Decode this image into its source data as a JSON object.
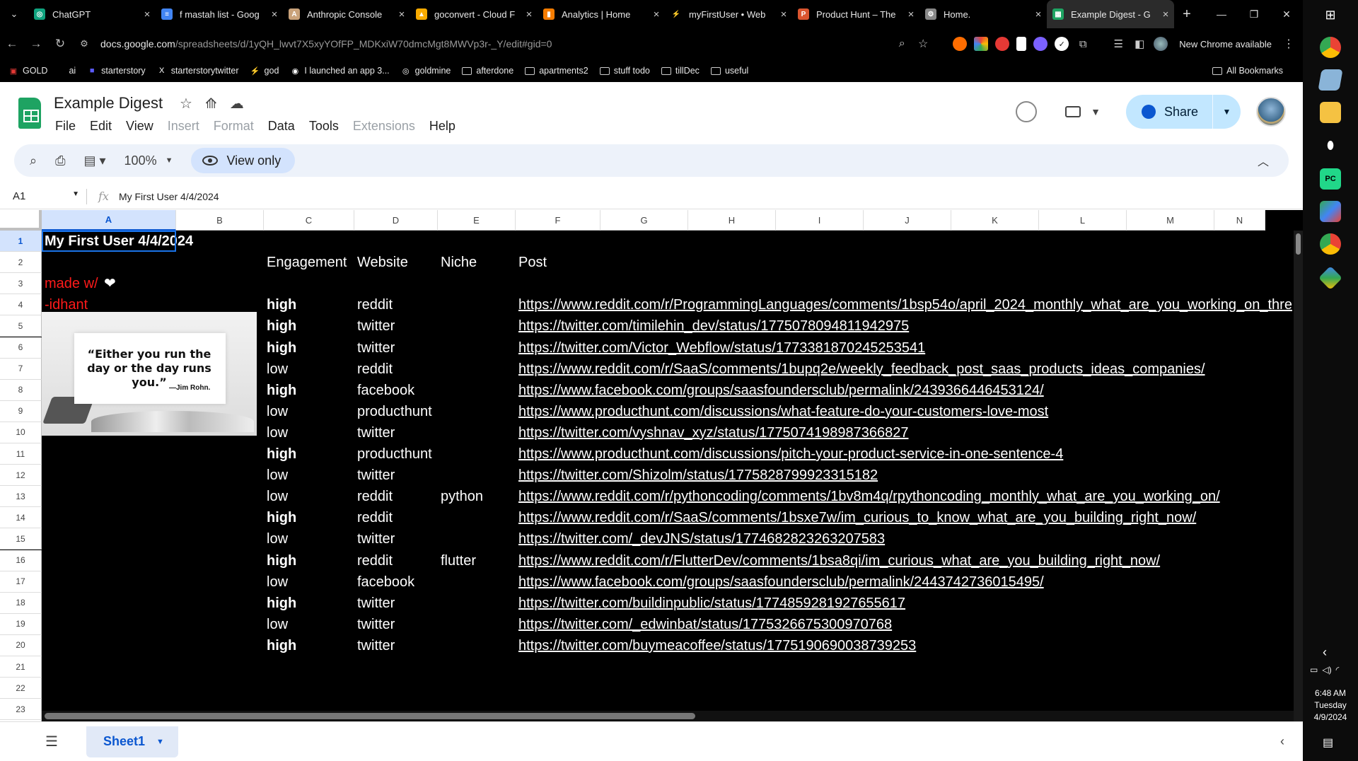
{
  "browser": {
    "tabs": [
      {
        "title": "ChatGPT",
        "color": "#10a37f",
        "glyph": "◎"
      },
      {
        "title": "f mastah list - Goog",
        "color": "#4285f4",
        "glyph": "≡"
      },
      {
        "title": "Anthropic Console",
        "color": "#c9a27a",
        "glyph": "A"
      },
      {
        "title": "goconvert - Cloud F",
        "color": "#f9ab00",
        "glyph": "▲"
      },
      {
        "title": "Analytics | Home",
        "color": "#f57c00",
        "glyph": "▮"
      },
      {
        "title": "myFirstUser • Web",
        "color": "#ffffff",
        "glyph": "⚡"
      },
      {
        "title": "Product Hunt – The",
        "color": "#da552f",
        "glyph": "P"
      },
      {
        "title": "Home.",
        "color": "#888888",
        "glyph": "⚙"
      },
      {
        "title": "Example Digest - G",
        "color": "#1ea362",
        "glyph": "▦"
      }
    ],
    "url_host": "docs.google.com",
    "url_path": "/spreadsheets/d/1yQH_lwvt7X5xyYOfFP_MDKxiW70dmcMgt8MWVp3r-_Y/edit#gid=0",
    "new_chrome_label": "New Chrome available",
    "bookmarks": [
      {
        "label": "GOLD",
        "kind": "icon",
        "color": "#e53935",
        "glyph": "▣"
      },
      {
        "label": "ai",
        "kind": "text"
      },
      {
        "label": "starterstory",
        "kind": "icon",
        "color": "#5b5bff",
        "glyph": "■"
      },
      {
        "label": "starterstorytwitter",
        "kind": "icon",
        "color": "#fff",
        "glyph": "X"
      },
      {
        "label": "god",
        "kind": "icon",
        "color": "#fff",
        "glyph": "⚡"
      },
      {
        "label": "I launched an app 3...",
        "kind": "icon",
        "color": "#fff",
        "glyph": "◉"
      },
      {
        "label": "goldmine",
        "kind": "icon",
        "color": "#fff",
        "glyph": "◎"
      },
      {
        "label": "afterdone",
        "kind": "folder"
      },
      {
        "label": "apartments2",
        "kind": "folder"
      },
      {
        "label": "stuff todo",
        "kind": "folder"
      },
      {
        "label": "tillDec",
        "kind": "folder"
      },
      {
        "label": "useful",
        "kind": "folder"
      }
    ],
    "all_bookmarks_label": "All Bookmarks"
  },
  "sheets": {
    "title": "Example Digest",
    "menu": [
      {
        "label": "File",
        "enabled": true
      },
      {
        "label": "Edit",
        "enabled": true
      },
      {
        "label": "View",
        "enabled": true
      },
      {
        "label": "Insert",
        "enabled": false
      },
      {
        "label": "Format",
        "enabled": false
      },
      {
        "label": "Data",
        "enabled": true
      },
      {
        "label": "Tools",
        "enabled": true
      },
      {
        "label": "Extensions",
        "enabled": false
      },
      {
        "label": "Help",
        "enabled": true
      }
    ],
    "share_label": "Share",
    "zoom": "100%",
    "view_only_label": "View only",
    "name_box": "A1",
    "formula": "My First User 4/4/2024",
    "columns": [
      "A",
      "B",
      "C",
      "D",
      "E",
      "F",
      "G",
      "H",
      "I",
      "J",
      "K",
      "L",
      "M",
      "N"
    ],
    "row_count": 24,
    "sheet_tab": "Sheet1"
  },
  "content": {
    "title": "My First User 4/4/2024",
    "made_with": "made w/ ",
    "heart": "❤",
    "author": "-idhant",
    "quote": "“Either you run the day or the day runs you.”",
    "quote_author": "—Jim Rohn.",
    "headers": {
      "engagement": "Engagement",
      "website": "Website",
      "niche": "Niche",
      "post": "Post"
    },
    "rows": [
      {
        "row": 4,
        "engagement": "high",
        "website": "reddit",
        "niche": "",
        "post": "https://www.reddit.com/r/ProgrammingLanguages/comments/1bsp54o/april_2024_monthly_what_are_you_working_on_thre"
      },
      {
        "row": 5,
        "engagement": "high",
        "website": "twitter",
        "niche": "",
        "post": "https://twitter.com/timilehin_dev/status/1775078094811942975"
      },
      {
        "row": 6,
        "engagement": "high",
        "website": "twitter",
        "niche": "",
        "post": "https://twitter.com/Victor_Webflow/status/1773381870245253541"
      },
      {
        "row": 7,
        "engagement": "low",
        "website": "reddit",
        "niche": "",
        "post": "https://www.reddit.com/r/SaaS/comments/1bupq2e/weekly_feedback_post_saas_products_ideas_companies/"
      },
      {
        "row": 8,
        "engagement": "high",
        "website": "facebook",
        "niche": "",
        "post": "https://www.facebook.com/groups/saasfoundersclub/permalink/2439366446453124/"
      },
      {
        "row": 9,
        "engagement": "low",
        "website": "producthunt",
        "niche": "",
        "post": "https://www.producthunt.com/discussions/what-feature-do-your-customers-love-most"
      },
      {
        "row": 10,
        "engagement": "low",
        "website": "twitter",
        "niche": "",
        "post": "https://twitter.com/vyshnav_xyz/status/1775074198987366827"
      },
      {
        "row": 11,
        "engagement": "high",
        "website": "producthunt",
        "niche": "",
        "post": "https://www.producthunt.com/discussions/pitch-your-product-service-in-one-sentence-4"
      },
      {
        "row": 12,
        "engagement": "low",
        "website": "twitter",
        "niche": "",
        "post": "https://twitter.com/Shizolm/status/1775828799923315182"
      },
      {
        "row": 13,
        "engagement": "low",
        "website": "reddit",
        "niche": "python",
        "post": "https://www.reddit.com/r/pythoncoding/comments/1bv8m4q/rpythoncoding_monthly_what_are_you_working_on/"
      },
      {
        "row": 14,
        "engagement": "high",
        "website": "reddit",
        "niche": "",
        "post": "https://www.reddit.com/r/SaaS/comments/1bsxe7w/im_curious_to_know_what_are_you_building_right_now/"
      },
      {
        "row": 15,
        "engagement": "low",
        "website": "twitter",
        "niche": "",
        "post": "https://twitter.com/_devJNS/status/1774682823263207583"
      },
      {
        "row": 16,
        "engagement": "high",
        "website": "reddit",
        "niche": "flutter",
        "post": "https://www.reddit.com/r/FlutterDev/comments/1bsa8qi/im_curious_what_are_you_building_right_now/"
      },
      {
        "row": 17,
        "engagement": "low",
        "website": "facebook",
        "niche": "",
        "post": "https://www.facebook.com/groups/saasfoundersclub/permalink/2443742736015495/"
      },
      {
        "row": 18,
        "engagement": "high",
        "website": "twitter",
        "niche": "",
        "post": "https://twitter.com/buildinpublic/status/1774859281927655617"
      },
      {
        "row": 19,
        "engagement": "low",
        "website": "twitter",
        "niche": "",
        "post": "https://twitter.com/_edwinbat/status/1775326675300970768"
      },
      {
        "row": 20,
        "engagement": "high",
        "website": "twitter",
        "niche": "",
        "post": "https://twitter.com/buymeacoffee/status/1775190690038739253"
      }
    ]
  },
  "os": {
    "time": "6:48 AM",
    "day": "Tuesday",
    "date": "4/9/2024"
  }
}
